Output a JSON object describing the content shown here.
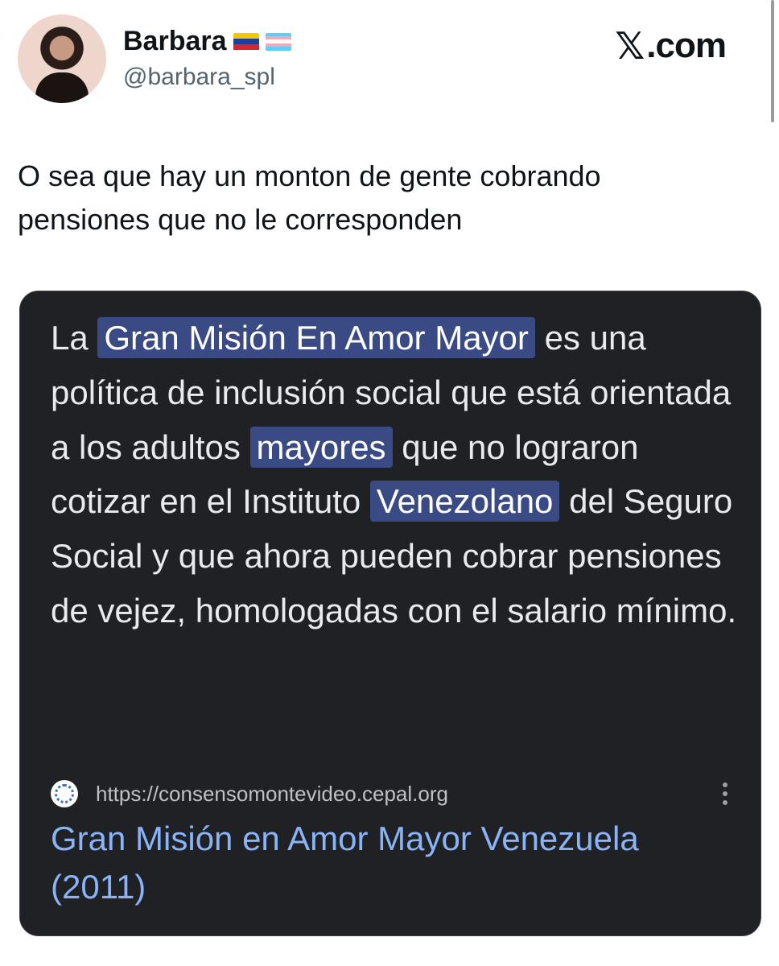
{
  "author": {
    "name": "Barbara",
    "handle": "@barbara_spl",
    "flags": [
      "venezuela-flag",
      "transgender-flag"
    ]
  },
  "brand": {
    "logo": "𝕏",
    "suffix": ".com"
  },
  "tweet": {
    "line1": "O sea que hay un monton de gente cobrando",
    "line2": "pensiones que no le corresponden"
  },
  "card": {
    "segments": {
      "s1": "La ",
      "hl1": "Gran Misión En Amor Mayor",
      "s2": " es una política de inclusión social que está orientada a los adultos ",
      "hl2": "mayores",
      "s3": " que no lograron cotizar en el Instituto ",
      "hl3": "Venezolano",
      "s4": " del Seguro Social y que ahora pueden cobrar pensiones de vejez, homologadas con el salario mínimo."
    },
    "source_url": "https://consensomontevideo.cepal.org",
    "result_title": "Gran Misión en Amor Mayor Venezuela (2011)"
  },
  "colors": {
    "card_bg": "#202124",
    "highlight": "#394a84",
    "link": "#8ab4f8",
    "handle": "#536471"
  }
}
